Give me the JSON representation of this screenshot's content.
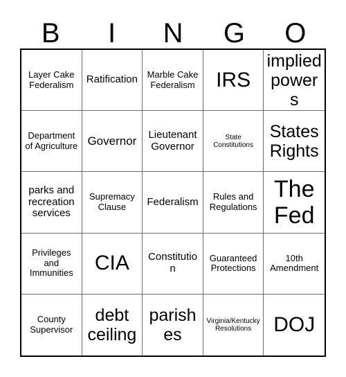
{
  "card": {
    "header_letters": [
      "B",
      "I",
      "N",
      "G",
      "O"
    ],
    "columns": 5,
    "rows": 5,
    "colors": {
      "background": "#ffffff",
      "text": "#000000",
      "outer_border": "#000000",
      "inner_border": "#6b6b6b"
    },
    "cells": [
      {
        "text": "Layer Cake Federalism",
        "size": "sm"
      },
      {
        "text": "Ratification",
        "size": "md"
      },
      {
        "text": "Marble Cake Federalism",
        "size": "sm"
      },
      {
        "text": "IRS",
        "size": "xxl"
      },
      {
        "text": "implied powers",
        "size": "xl"
      },
      {
        "text": "Department of Agriculture",
        "size": "sm"
      },
      {
        "text": "Governor",
        "size": "lg"
      },
      {
        "text": "Lieutenant Governor",
        "size": "md"
      },
      {
        "text": "State Constitutions",
        "size": "xs"
      },
      {
        "text": "States Rights",
        "size": "xl"
      },
      {
        "text": "parks and recreation services",
        "size": "md"
      },
      {
        "text": "Supremacy Clause",
        "size": "sm"
      },
      {
        "text": "Federalism",
        "size": "md"
      },
      {
        "text": "Rules and Regulations",
        "size": "sm"
      },
      {
        "text": "The Fed",
        "size": "huge"
      },
      {
        "text": "Privileges and Immunities",
        "size": "sm"
      },
      {
        "text": "CIA",
        "size": "xxl"
      },
      {
        "text": "Constitution",
        "size": "md"
      },
      {
        "text": "Guaranteed Protections",
        "size": "sm"
      },
      {
        "text": "10th Amendment",
        "size": "sm"
      },
      {
        "text": "County Supervisor",
        "size": "sm"
      },
      {
        "text": "debt ceiling",
        "size": "xl"
      },
      {
        "text": "parishes",
        "size": "xl"
      },
      {
        "text": "Virginia/Kentucky Resolutions",
        "size": "xs"
      },
      {
        "text": "DOJ",
        "size": "xxl"
      }
    ]
  }
}
